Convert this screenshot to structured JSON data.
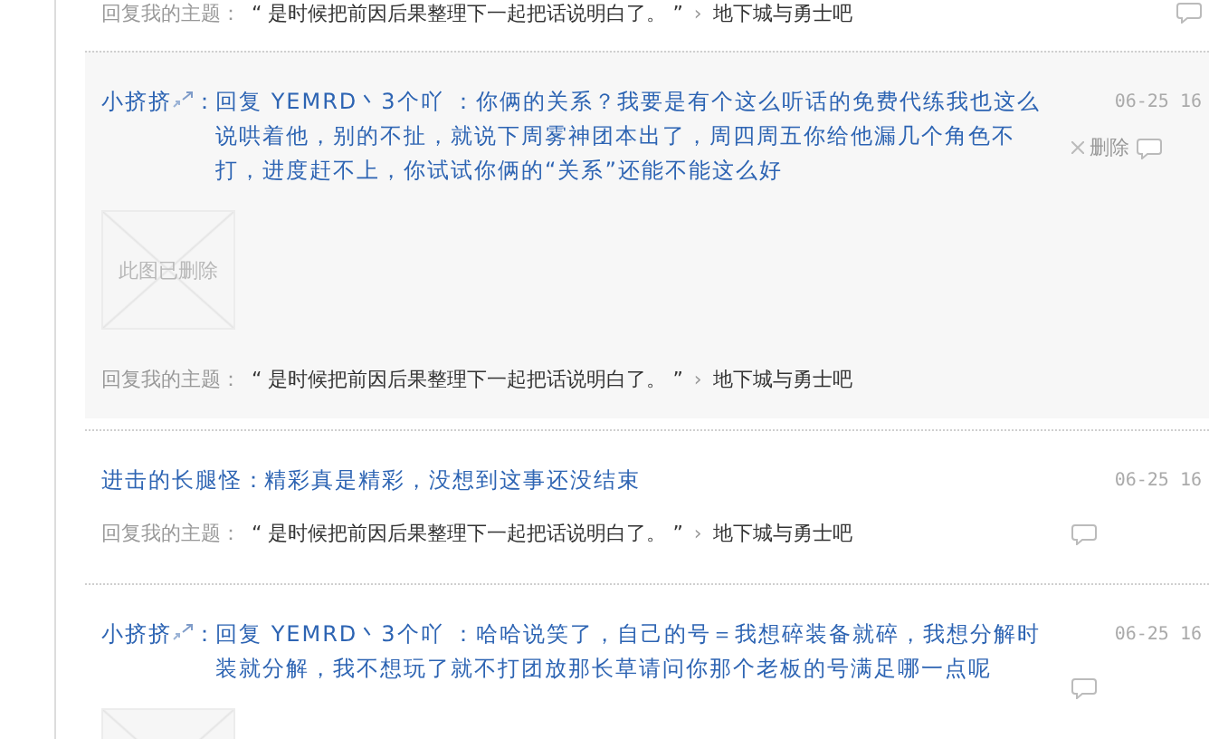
{
  "top_reply": {
    "label": "回复我的主题：",
    "topic": "“ 是时候把前因后果整理下一起把话说明白了。 ”",
    "separator": "›",
    "forum": "地下城与勇士吧"
  },
  "items": [
    {
      "author": "小挤挤",
      "badge": true,
      "colon": "：",
      "message": "回复 YEMRD丶3个吖 ：你俩的关系？我要是有个这么听话的免费代练我也这么说哄着他，别的不扯，就说下周雾神团本出了，周四周五你给他漏几个角色不打，进度赶不上，你试试你俩的“关系”还能不能这么好",
      "hovered": true,
      "image": {
        "kind": "deleted",
        "caption": "此图已删除"
      },
      "reply": {
        "label": "回复我的主题：",
        "topic": "“ 是时候把前因后果整理下一起把话说明白了。 ”",
        "separator": "›",
        "forum": "地下城与勇士吧"
      },
      "date": "06-25 16",
      "delete": {
        "label": "删除"
      }
    },
    {
      "author": "进击的长腿怪",
      "badge": false,
      "colon": "：",
      "message": "精彩真是精彩，没想到这事还没结束",
      "hovered": false,
      "reply": {
        "label": "回复我的主题：",
        "topic": "“ 是时候把前因后果整理下一起把话说明白了。 ”",
        "separator": "›",
        "forum": "地下城与勇士吧"
      },
      "date": "06-25 16"
    },
    {
      "author": "小挤挤",
      "badge": true,
      "colon": "：",
      "message": "回复 YEMRD丶3个吖 ：哈哈说笑了，自己的号＝我想碎装备就碎，我想分解时装就分解，我不想玩了就不打团放那长草请问你那个老板的号满足哪一点呢",
      "hovered": false,
      "image": {
        "kind": "deleted"
      },
      "date": "06-25 16"
    }
  ]
}
